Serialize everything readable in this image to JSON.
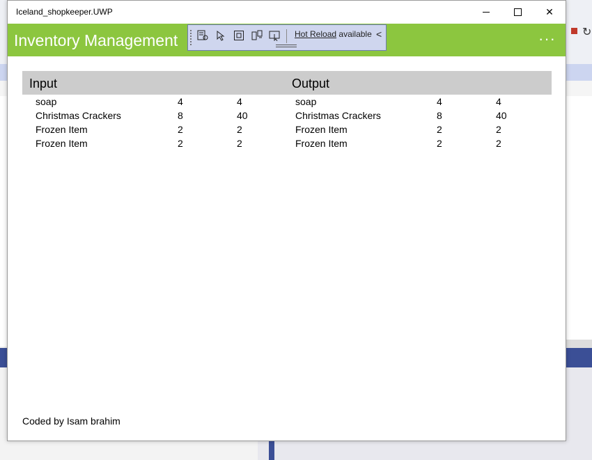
{
  "window": {
    "title": "Iceland_shopkeeper.UWP",
    "controls": {
      "minimize_icon": "minimize-icon",
      "maximize_icon": "maximize-icon",
      "close_icon": "close-icon",
      "close_glyph": "✕"
    }
  },
  "header": {
    "title": "Inventory Management",
    "more_label": "···",
    "background_color": "#8cc63f"
  },
  "toolbar": {
    "hot_reload_link": "Hot Reload",
    "hot_reload_status": "available",
    "collapse_glyph": "<"
  },
  "input": {
    "heading": "Input",
    "rows": [
      {
        "name": "soap",
        "qty": "4",
        "total": "4"
      },
      {
        "name": "Christmas Crackers",
        "qty": "8",
        "total": "40"
      },
      {
        "name": "Frozen Item",
        "qty": "2",
        "total": "2"
      },
      {
        "name": "Frozen Item",
        "qty": "2",
        "total": "2"
      }
    ]
  },
  "output": {
    "heading": "Output",
    "rows": [
      {
        "name": "soap",
        "qty": "4",
        "total": "4"
      },
      {
        "name": "Christmas Crackers",
        "qty": "8",
        "total": "40"
      },
      {
        "name": "Frozen Item",
        "qty": "2",
        "total": "2"
      },
      {
        "name": "Frozen Item",
        "qty": "2",
        "total": "2"
      }
    ]
  },
  "footer": {
    "text": "Coded by Isam brahim"
  }
}
